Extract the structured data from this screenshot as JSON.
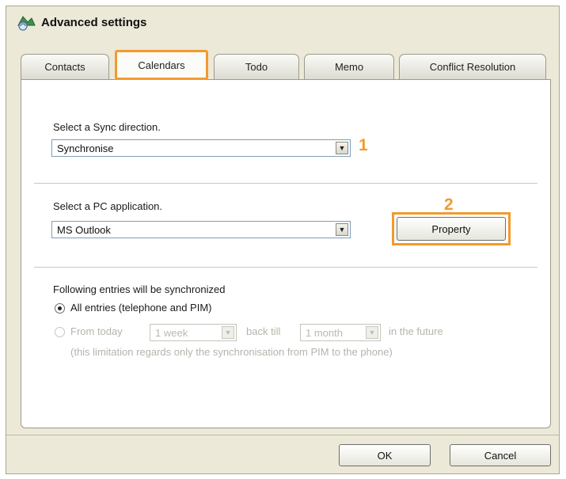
{
  "window": {
    "title": "Advanced settings"
  },
  "tabs": [
    {
      "label": "Contacts",
      "active": false
    },
    {
      "label": "Calendars",
      "active": true
    },
    {
      "label": "Todo",
      "active": false
    },
    {
      "label": "Memo",
      "active": false
    },
    {
      "label": "Conflict Resolution",
      "active": false
    }
  ],
  "sync_section": {
    "label": "Select a Sync direction.",
    "selected": "Synchronise",
    "marker": "1"
  },
  "pc_section": {
    "label": "Select a PC application.",
    "selected": "MS Outlook",
    "property_button": "Property",
    "marker": "2"
  },
  "entries_section": {
    "heading": "Following entries will be synchronized",
    "option_all": "All entries (telephone and PIM)",
    "option_from_today": "From today",
    "back_value": "1 week",
    "back_till_text": "back till",
    "future_value": "1 month",
    "future_text": "in the future",
    "note": "(this limitation regards only the synchronisation from PIM to the phone)",
    "selected_option": "all"
  },
  "footer": {
    "ok": "OK",
    "cancel": "Cancel"
  },
  "colors": {
    "highlight": "#f39a2c",
    "dialog_bg": "#ece9d8"
  }
}
